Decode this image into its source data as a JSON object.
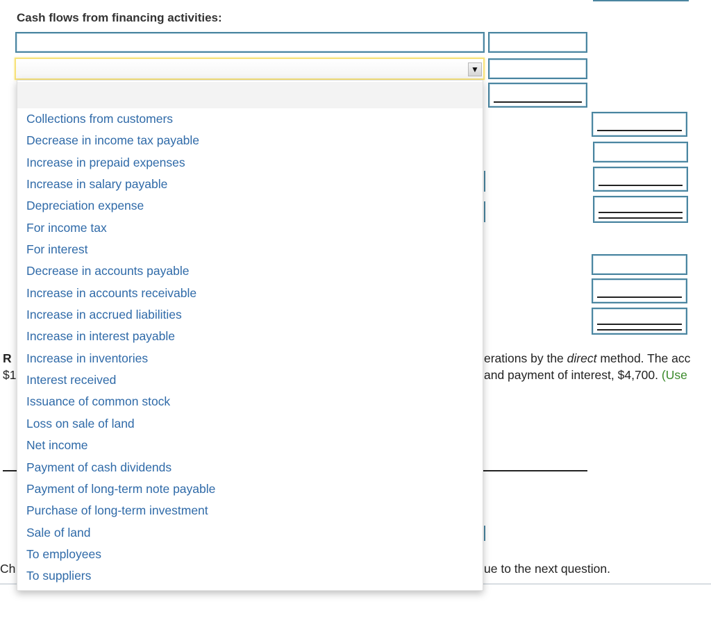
{
  "section_heading": "Cash flows from financing activities:",
  "dropdown": {
    "selected": "",
    "arrow_icon": "▼",
    "options": [
      "Collections from customers",
      "Decrease in income tax payable",
      "Increase in prepaid expenses",
      "Increase in salary payable",
      "Depreciation expense",
      "For income tax",
      "For interest",
      "Decrease in accounts payable",
      "Increase in accounts receivable",
      "Increase in accrued liabilities",
      "Increase in interest payable",
      "Increase in inventories",
      "Interest received",
      "Issuance of common stock",
      "Loss on sale of land",
      "Net income",
      "Payment of cash dividends",
      "Payment of long-term note payable",
      "Purchase of long-term investment",
      "Sale of land",
      "To employees",
      "To suppliers"
    ]
  },
  "background_text": {
    "left_bold_fragment": "R",
    "left_dollar_fragment": "$1",
    "line1_part1": "erations by the ",
    "line1_italic": "direct",
    "line1_part2": " method. The acc",
    "line2_main": "and payment of interest, $4,700. ",
    "line2_green": "(Use",
    "bottom_left_fragment": "Ch",
    "bottom_right_fragment": "ue to the next question."
  }
}
